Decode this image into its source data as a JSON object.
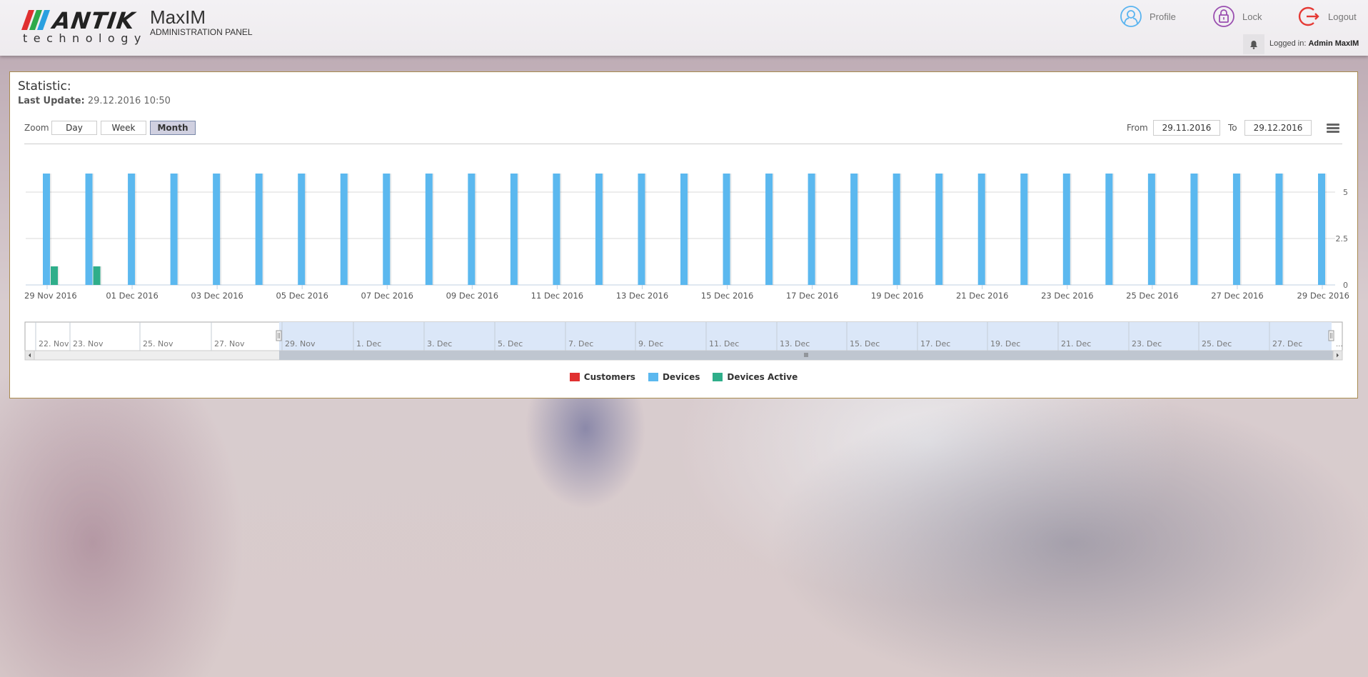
{
  "header": {
    "brand": "ANTIK",
    "brand_sub": "technology",
    "app_name": "MaxIM",
    "app_sub": "ADMINISTRATION PANEL",
    "nav": [
      {
        "label": "Profile",
        "icon": "user-icon",
        "color": "#5ab4f0"
      },
      {
        "label": "Lock",
        "icon": "lock-icon",
        "color": "#9a4fb0"
      },
      {
        "label": "Logout",
        "icon": "logout-icon",
        "color": "#e53a35"
      }
    ],
    "logged_in_label": "Logged in:",
    "logged_in_user": "Admin MaxIM"
  },
  "panel": {
    "title": "Statistic:",
    "last_update_label": "Last Update:",
    "last_update_value": "29.12.2016 10:50",
    "zoom_label": "Zoom",
    "zoom_buttons": [
      {
        "label": "Day",
        "active": false
      },
      {
        "label": "Week",
        "active": false
      },
      {
        "label": "Month",
        "active": true
      }
    ],
    "from_label": "From",
    "from_value": "29.11.2016",
    "to_label": "To",
    "to_value": "29.12.2016"
  },
  "chart_data": {
    "type": "bar",
    "title": "",
    "xlabel": "",
    "ylabel": "",
    "categories": [
      "29 Nov 2016",
      "30 Nov 2016",
      "01 Dec 2016",
      "02 Dec 2016",
      "03 Dec 2016",
      "04 Dec 2016",
      "05 Dec 2016",
      "06 Dec 2016",
      "07 Dec 2016",
      "08 Dec 2016",
      "09 Dec 2016",
      "10 Dec 2016",
      "11 Dec 2016",
      "12 Dec 2016",
      "13 Dec 2016",
      "14 Dec 2016",
      "15 Dec 2016",
      "16 Dec 2016",
      "17 Dec 2016",
      "18 Dec 2016",
      "19 Dec 2016",
      "20 Dec 2016",
      "21 Dec 2016",
      "22 Dec 2016",
      "23 Dec 2016",
      "24 Dec 2016",
      "25 Dec 2016",
      "26 Dec 2016",
      "27 Dec 2016",
      "28 Dec 2016",
      "29 Dec 2016"
    ],
    "x_tick_labels": [
      "29 Nov 2016",
      "01 Dec 2016",
      "03 Dec 2016",
      "05 Dec 2016",
      "07 Dec 2016",
      "09 Dec 2016",
      "11 Dec 2016",
      "13 Dec 2016",
      "15 Dec 2016",
      "17 Dec 2016",
      "19 Dec 2016",
      "21 Dec 2016",
      "23 Dec 2016",
      "25 Dec 2016",
      "27 Dec 2016",
      "29 Dec 2016"
    ],
    "y_ticks": [
      0,
      2.5,
      5
    ],
    "ylim": [
      0,
      6
    ],
    "y_axis_side": "right",
    "grid": true,
    "series": [
      {
        "name": "Customers",
        "color": "#e03030",
        "values": [
          0,
          0,
          0,
          0,
          0,
          0,
          0,
          0,
          0,
          0,
          0,
          0,
          0,
          0,
          0,
          0,
          0,
          0,
          0,
          0,
          0,
          0,
          0,
          0,
          0,
          0,
          0,
          0,
          0,
          0,
          0
        ]
      },
      {
        "name": "Devices",
        "color": "#5bb8ef",
        "values": [
          6,
          6,
          6,
          6,
          6,
          6,
          6,
          6,
          6,
          6,
          6,
          6,
          6,
          6,
          6,
          6,
          6,
          6,
          6,
          6,
          6,
          6,
          6,
          6,
          6,
          6,
          6,
          6,
          6,
          6,
          6
        ]
      },
      {
        "name": "Devices Active",
        "color": "#2fae8a",
        "values": [
          1,
          1,
          0,
          0,
          0,
          0,
          0,
          0,
          0,
          0,
          0,
          0,
          0,
          0,
          0,
          0,
          0,
          0,
          0,
          0,
          0,
          0,
          0,
          0,
          0,
          0,
          0,
          0,
          0,
          0,
          0
        ]
      }
    ],
    "legend_position": "bottom-center",
    "navigator": {
      "labels": [
        "22. Nov",
        "23. Nov",
        "25. Nov",
        "27. Nov",
        "29. Nov",
        "1. Dec",
        "3. Dec",
        "5. Dec",
        "7. Dec",
        "9. Dec",
        "11. Dec",
        "13. Dec",
        "15. Dec",
        "17. Dec",
        "19. Dec",
        "21. Dec",
        "23. Dec",
        "25. Dec",
        "27. Dec"
      ],
      "range_start": "29. Nov",
      "range_end": "29. Dec",
      "overflow_label": "..."
    }
  }
}
